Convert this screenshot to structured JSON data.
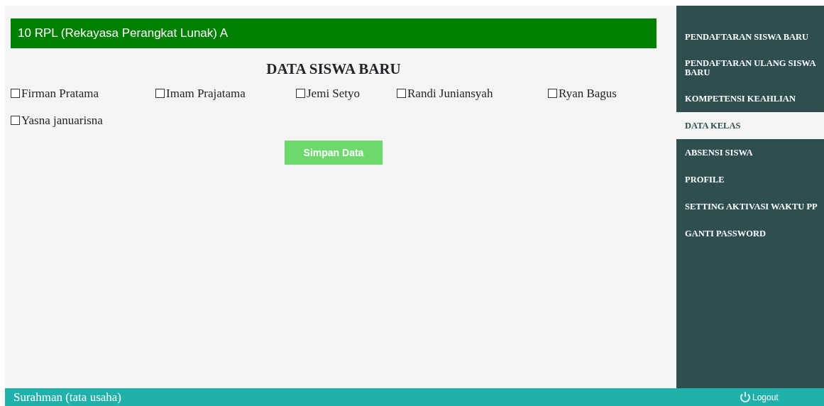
{
  "class_bar": {
    "title": "10 RPL (Rekayasa Perangkat Lunak) A"
  },
  "heading": "DATA SISWA BARU",
  "students": [
    {
      "name": "Firman Pratama",
      "checked": false
    },
    {
      "name": "Imam Prajatama",
      "checked": false
    },
    {
      "name": "Jemi Setyo",
      "checked": false
    },
    {
      "name": "Randi Juniansyah",
      "checked": false
    },
    {
      "name": "Ryan Bagus",
      "checked": false
    },
    {
      "name": "Yasna januarisna",
      "checked": false
    }
  ],
  "save_button": "Simpan Data",
  "sidebar": {
    "items": [
      {
        "label": "PENDAFTARAN SISWA BARU",
        "selected": false
      },
      {
        "label": "PENDAFTARAN ULANG SISWA BARU",
        "selected": false
      },
      {
        "label": "KOMPETENSI KEAHLIAN",
        "selected": false
      },
      {
        "label": "DATA KELAS",
        "selected": true
      },
      {
        "label": "ABSENSI SISWA",
        "selected": false
      },
      {
        "label": "PROFILE",
        "selected": false
      },
      {
        "label": "SETTING AKTIVASI WAKTU PP",
        "selected": false
      },
      {
        "label": "GANTI PASSWORD",
        "selected": false
      }
    ]
  },
  "footer": {
    "user": "Surahman (tata usaha)",
    "logout": "Logout"
  }
}
